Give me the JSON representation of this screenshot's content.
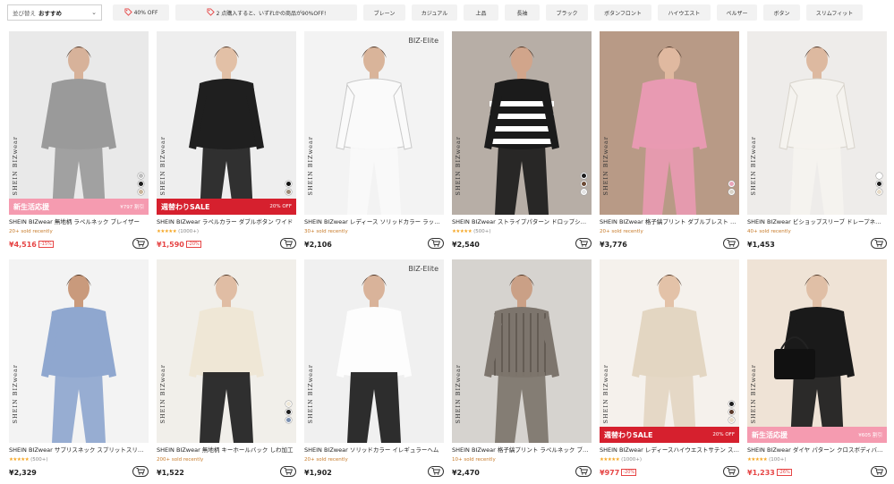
{
  "filters": {
    "sort_label": "並び替え",
    "sort_value": "おすすめ",
    "chips": [
      {
        "label": "40% OFF",
        "icon": "tag-icon",
        "width": 63
      },
      {
        "label": "2 点購入すると、いずれかの商品が90%OFF!",
        "icon": "tag-icon",
        "width": 203
      },
      {
        "label": "ブレーン",
        "width": 47
      },
      {
        "label": "カジュアル",
        "width": 51
      },
      {
        "label": "上品",
        "width": 39
      },
      {
        "label": "長袖",
        "width": 39
      },
      {
        "label": "ブラック",
        "width": 47
      },
      {
        "label": "ボタンフロント",
        "width": 64
      },
      {
        "label": "ハイウエスト",
        "width": 59
      },
      {
        "label": "ペルザー",
        "width": 45
      },
      {
        "label": "ボタン",
        "width": 41
      },
      {
        "label": "スリムフィット",
        "width": 63
      }
    ]
  },
  "products": [
    {
      "title": "SHEIN BIZwear 無地柄 ラペルネック ブレイザー",
      "sold": "20+ sold recently",
      "price": "¥4,516",
      "discount": "-15%",
      "banner": {
        "style": "pink",
        "left": "新生活応援",
        "right": "¥797 割引"
      },
      "swatches": [
        "#bdbdbd",
        "#1c1c1c",
        "#c8b49a"
      ]
    },
    {
      "title": "SHEIN BIZwear ラペルカラー ダブルボタン ワイド",
      "reviews": "(1000+)",
      "price": "¥1,590",
      "discount": "-20%",
      "banner": {
        "style": "red",
        "left": "週替わりSALE",
        "right": "20% OFF"
      },
      "swatches": [
        "#111111",
        "#9b8a76"
      ]
    },
    {
      "title": "SHEIN BIZwear レディース ソリッドカラー ラッフル",
      "sold": "30+ sold recently",
      "price": "¥2,106",
      "badge": "BIZ-Elite"
    },
    {
      "title": "SHEIN BIZwear ストライプパターン ドロップショルダー",
      "reviews": "(500+)",
      "price": "¥2,540",
      "swatches": [
        "#1c1c1c",
        "#6b4a35",
        "#e3e3e3"
      ]
    },
    {
      "title": "SHEIN BIZwear 格子縞プリント ダブルブレスト ブレザー",
      "sold": "20+ sold recently",
      "price": "¥3,776",
      "swatches": [
        "#e9a3b8",
        "#d8d3c8"
      ]
    },
    {
      "title": "SHEIN BIZwear ビショップスリーブ ドレープネック",
      "sold": "40+ sold recently",
      "price": "¥1,453",
      "swatches": [
        "#ffffff",
        "#1c1c1c",
        "#e8dcc8"
      ]
    },
    {
      "title": "SHEIN BIZwear サプリスネック スプリットスリーブ",
      "reviews": "(500+)",
      "price": "¥2,329"
    },
    {
      "title": "SHEIN BIZwear 無地柄 キーホールバック しわ加工",
      "sold": "200+ sold recently",
      "price": "¥1,522",
      "swatches": [
        "#efe8d8",
        "#1c1c1c",
        "#7a8fb0"
      ]
    },
    {
      "title": "SHEIN BIZwear ソリッドカラー イレギュラーヘム",
      "sold": "20+ sold recently",
      "price": "¥1,902",
      "badge": "BIZ-Elite"
    },
    {
      "title": "SHEIN BIZwear 格子縞プリント ラペルネック ブレザー",
      "sold": "10+ sold recently",
      "price": "¥2,470"
    },
    {
      "title": "SHEIN BIZwear レディースハイウエストサテン スカート",
      "reviews": "(1000+)",
      "price": "¥977",
      "discount": "-20%",
      "banner": {
        "style": "red",
        "left": "週替わりSALE",
        "right": "20% OFF"
      },
      "swatches": [
        "#1c1c1c",
        "#5a3a2a",
        "#e8dcc8"
      ]
    },
    {
      "title": "SHEIN BIZwear ダイヤ パターン クロスボディバッグ",
      "reviews": "(100+)",
      "price": "¥1,233",
      "discount": "-26%",
      "banner": {
        "style": "pink",
        "left": "新生活応援",
        "right": "¥605 割引"
      }
    }
  ]
}
